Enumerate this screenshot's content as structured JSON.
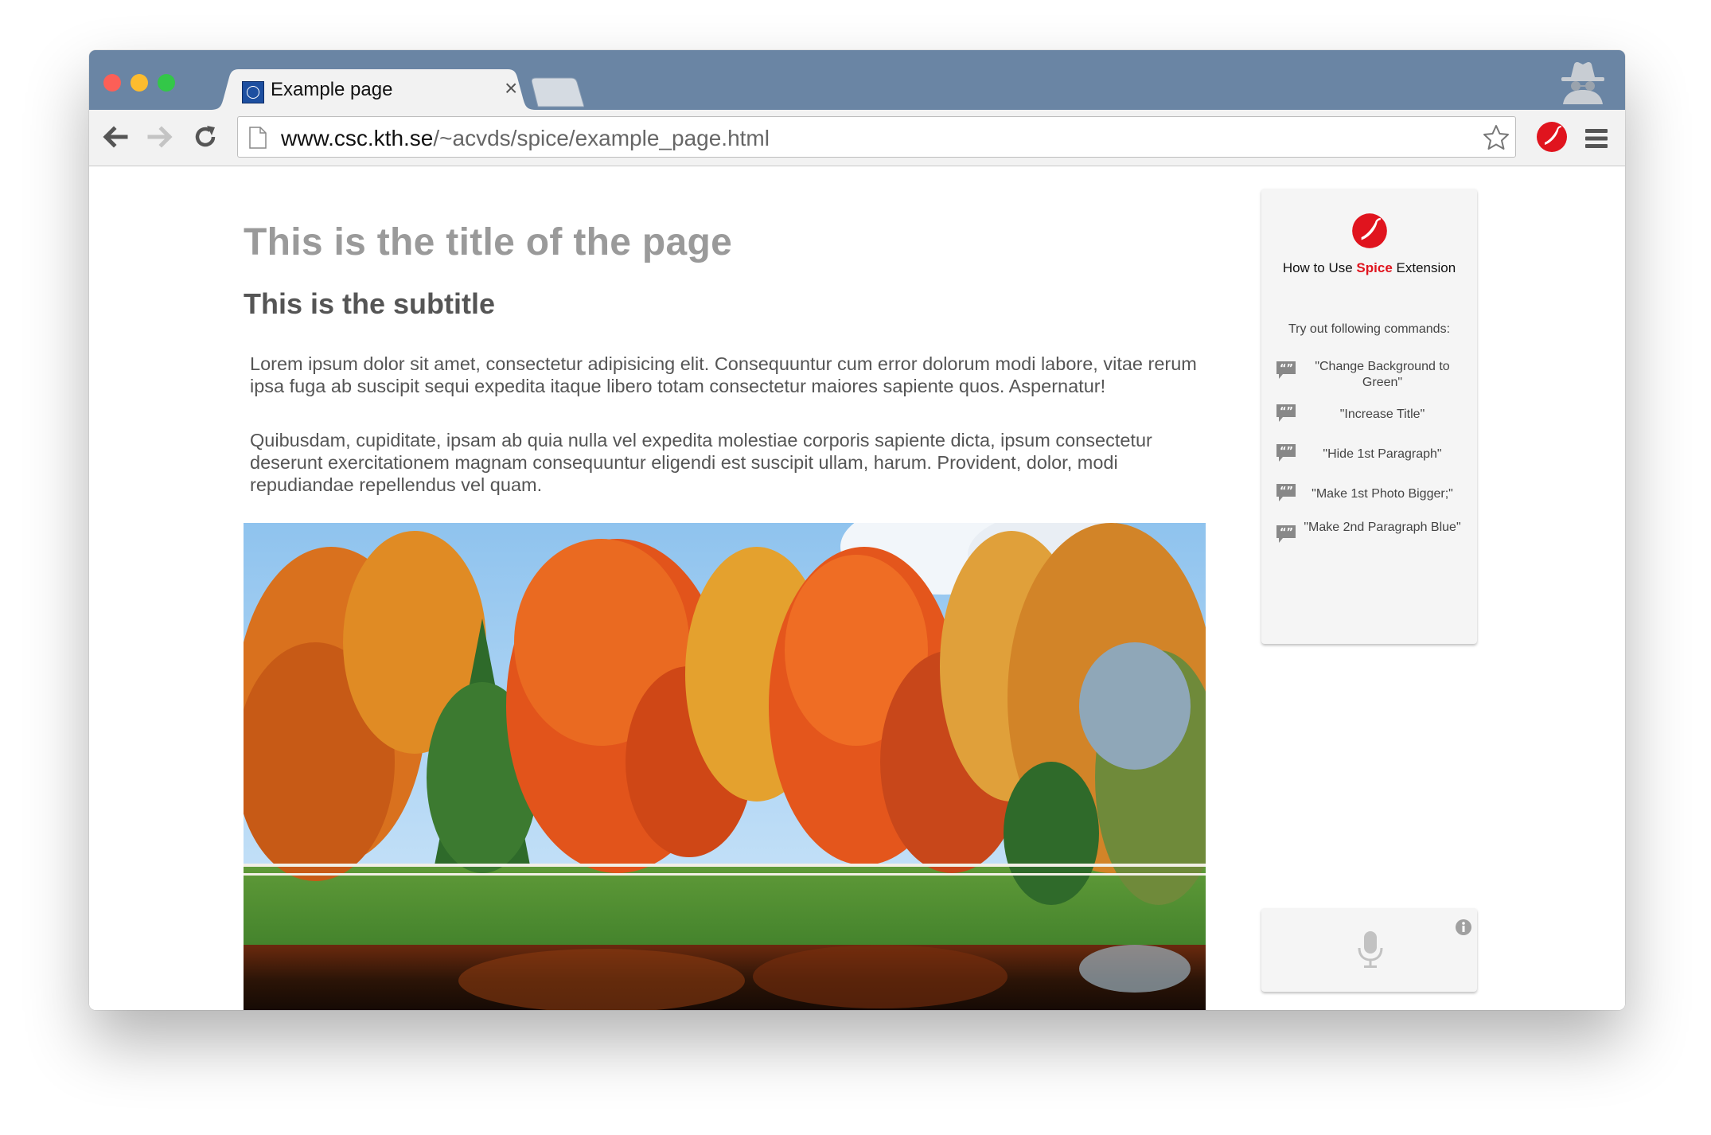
{
  "browser": {
    "tab_title": "Example page",
    "tab_close": "×",
    "url_host": "www.csc.kth.se",
    "url_path": "/~acvds/spice/example_page.html"
  },
  "page": {
    "title": "This is the title of the page",
    "subtitle": "This is the subtitle",
    "paragraphs": [
      "Lorem ipsum dolor sit amet, consectetur adipisicing elit. Consequuntur cum error dolorum modi labore, vitae rerum ipsa fuga ab suscipit sequi expedita itaque libero totam consectetur maiores sapiente quos. Aspernatur!",
      "Quibusdam, cupiditate, ipsam ab quia nulla vel expedita molestiae corporis sapiente dicta, ipsum consectetur deserunt exercitationem magnam consequuntur eligendi est suscipit ullam, harum. Provident, dolor, modi repudiandae repellendus vel quam."
    ]
  },
  "spice_panel": {
    "heading_prefix": "How to Use ",
    "heading_brand": "Spice",
    "heading_suffix": " Extension",
    "try_label": "Try out following commands:",
    "commands": [
      "\"Change Background to Green\"",
      "\"Increase Title\"",
      "\"Hide 1st Paragraph\"",
      "\"Make 1st Photo Bigger;\"",
      "\"Make 2nd Paragraph Blue\""
    ]
  },
  "colors": {
    "tabstrip": "#6a85a4",
    "spice_red": "#e0141e",
    "traffic_close": "#fc5f57",
    "traffic_min": "#fdbc2e",
    "traffic_max": "#33c748"
  },
  "icons": {
    "back": "arrow-left-icon",
    "forward": "arrow-right-icon",
    "reload": "reload-icon",
    "bookmark": "star-icon",
    "extension": "chili-pepper-icon",
    "menu": "hamburger-menu-icon",
    "incognito": "incognito-icon",
    "command": "quote-bubble-icon",
    "microphone": "microphone-icon",
    "info": "info-icon"
  }
}
